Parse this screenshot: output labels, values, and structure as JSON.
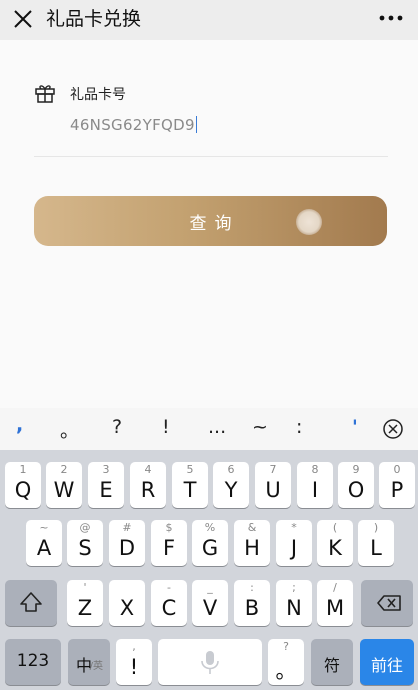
{
  "header": {
    "title": "礼品卡兑换",
    "close_icon": "close-icon",
    "more_icon": "more-icon"
  },
  "form": {
    "field_label": "礼品卡号",
    "field_icon": "gift-icon",
    "code_value": "46NSG62YFQD9"
  },
  "query_button": {
    "label": "查询"
  },
  "candidates": {
    "items": [
      ",",
      "。",
      "?",
      "!",
      "...",
      "~",
      ":",
      "'"
    ]
  },
  "keyboard": {
    "row1": [
      {
        "hint": "1",
        "key": "Q"
      },
      {
        "hint": "2",
        "key": "W"
      },
      {
        "hint": "3",
        "key": "E"
      },
      {
        "hint": "4",
        "key": "R"
      },
      {
        "hint": "5",
        "key": "T"
      },
      {
        "hint": "6",
        "key": "Y"
      },
      {
        "hint": "7",
        "key": "U"
      },
      {
        "hint": "8",
        "key": "I"
      },
      {
        "hint": "9",
        "key": "O"
      },
      {
        "hint": "0",
        "key": "P"
      }
    ],
    "row2": [
      {
        "hint": "~",
        "key": "A"
      },
      {
        "hint": "@",
        "key": "S"
      },
      {
        "hint": "#",
        "key": "D"
      },
      {
        "hint": "$",
        "key": "F"
      },
      {
        "hint": "%",
        "key": "G"
      },
      {
        "hint": "&",
        "key": "H"
      },
      {
        "hint": "*",
        "key": "J"
      },
      {
        "hint": "(",
        "key": "K"
      },
      {
        "hint": ")",
        "key": "L"
      }
    ],
    "row3": [
      {
        "hint": "'",
        "key": "Z"
      },
      {
        "hint": "",
        "key": "X"
      },
      {
        "hint": "-",
        "key": "C"
      },
      {
        "hint": "_",
        "key": "V"
      },
      {
        "hint": ":",
        "key": "B"
      },
      {
        "hint": ";",
        "key": "N"
      },
      {
        "hint": "/",
        "key": "M"
      }
    ],
    "num_label": "123",
    "lang_label": "中",
    "lang_sub": "/英",
    "punct_hint": ",",
    "punct_main": "!",
    "comma_hint": "?",
    "comma_main": "。",
    "symbol_label": "符",
    "go_label": "前往",
    "shift_icon": "shift-icon",
    "backspace_icon": "backspace-icon",
    "mic_icon": "mic-icon"
  }
}
